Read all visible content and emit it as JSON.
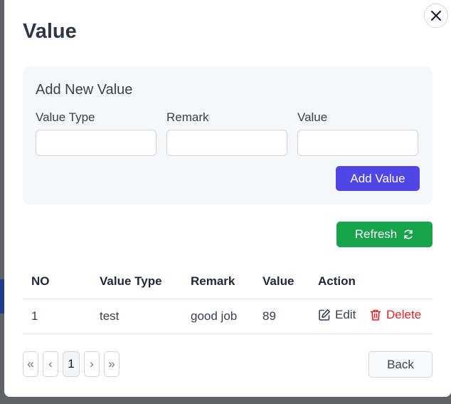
{
  "modal": {
    "title": "Value"
  },
  "form": {
    "heading": "Add New Value",
    "fields": [
      {
        "label": "Value Type",
        "value": "",
        "placeholder": ""
      },
      {
        "label": "Remark",
        "value": "",
        "placeholder": ""
      },
      {
        "label": "Value",
        "value": "",
        "placeholder": ""
      }
    ],
    "add_label": "Add Value"
  },
  "toolbar": {
    "refresh_label": "Refresh"
  },
  "table": {
    "columns": [
      "NO",
      "Value Type",
      "Remark",
      "Value",
      "Action"
    ],
    "rows": [
      {
        "no": "1",
        "value_type": "test",
        "remark": "good job",
        "value": "89",
        "edit_label": "Edit",
        "delete_label": "Delete"
      }
    ]
  },
  "pagination": {
    "first": "«",
    "prev": "‹",
    "current": "1",
    "next": "›",
    "last": "»"
  },
  "footer": {
    "back_label": "Back"
  },
  "colors": {
    "primary": "#4f46e5",
    "success": "#16a34a",
    "danger": "#dc2626"
  },
  "icons": {
    "close": "close-icon",
    "refresh": "refresh-icon",
    "edit": "edit-icon",
    "delete": "trash-icon"
  }
}
